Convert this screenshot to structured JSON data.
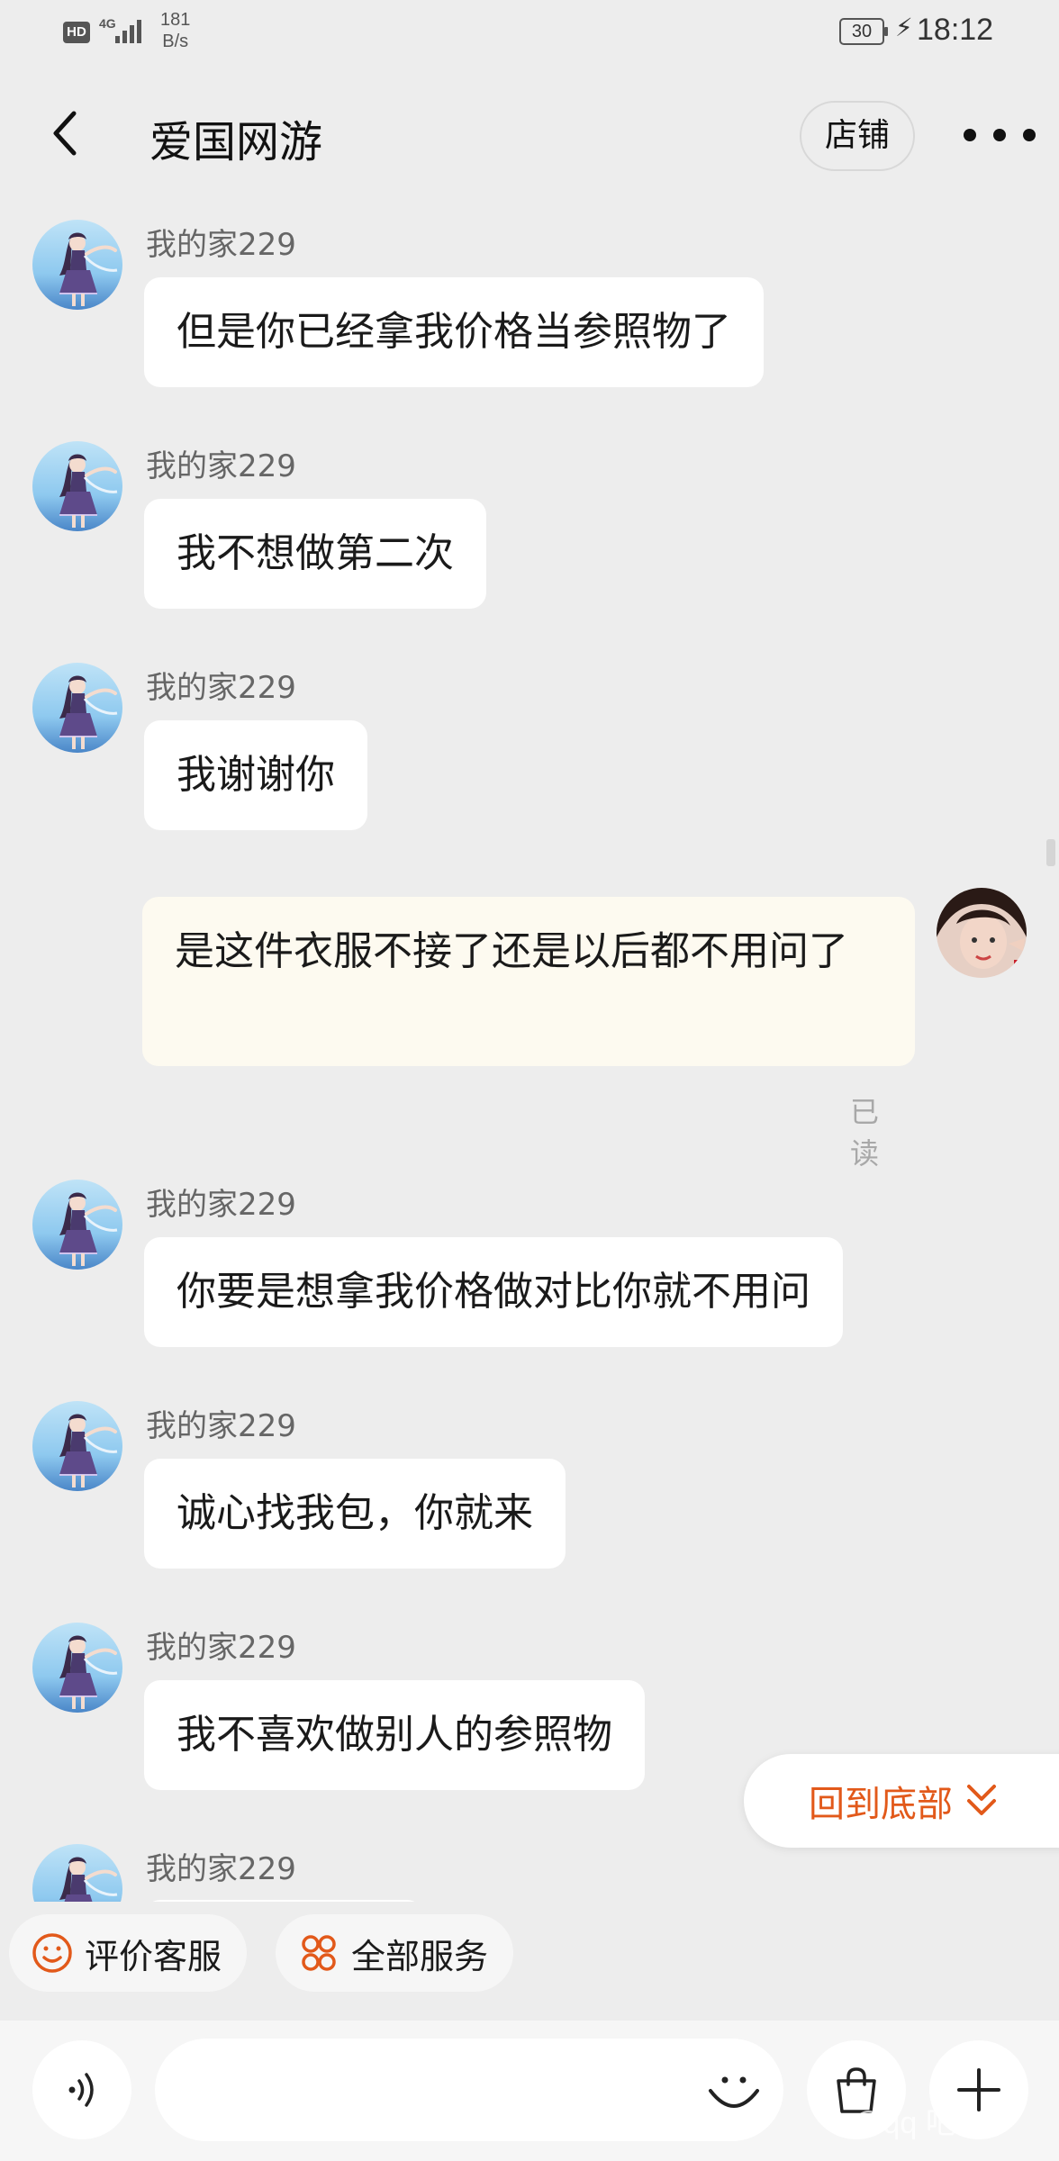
{
  "status_bar": {
    "hd": "HD",
    "network": "4G",
    "speed_value": "181",
    "speed_unit": "B/s",
    "battery": "30",
    "time": "18:12"
  },
  "header": {
    "title": "爱国网游",
    "shop_label": "店铺"
  },
  "messages": [
    {
      "sender": "我的家229",
      "text": "但是你已经拿我价格当参照物了"
    },
    {
      "sender": "我的家229",
      "text": "我不想做第二次"
    },
    {
      "sender": "我的家229",
      "text": "我谢谢你"
    },
    {
      "sender": "",
      "text": "是这件衣服不接了还是以后都不用问了",
      "read_status": "已读"
    },
    {
      "sender": "我的家229",
      "text": "你要是想拿我价格做对比你就不用问"
    },
    {
      "sender": "我的家229",
      "text": "诚心找我包，你就来"
    },
    {
      "sender": "我的家229",
      "text": "我不喜欢做别人的参照物"
    },
    {
      "sender": "我的家229",
      "text": ""
    }
  ],
  "back_to_bottom_label": "回到底部",
  "quick_actions": [
    {
      "label": "评价客服",
      "icon": "smile-icon"
    },
    {
      "label": "全部服务",
      "icon": "grid-services-icon"
    }
  ],
  "input_bar": {
    "placeholder": "",
    "icons": [
      "voice-icon",
      "emoji-icon",
      "shopping-bag-icon",
      "plus-icon"
    ]
  },
  "watermark": "@qq 吧",
  "colors": {
    "accent": "#e2591a",
    "background": "#ededed",
    "own_bubble": "#fdfaf0"
  }
}
